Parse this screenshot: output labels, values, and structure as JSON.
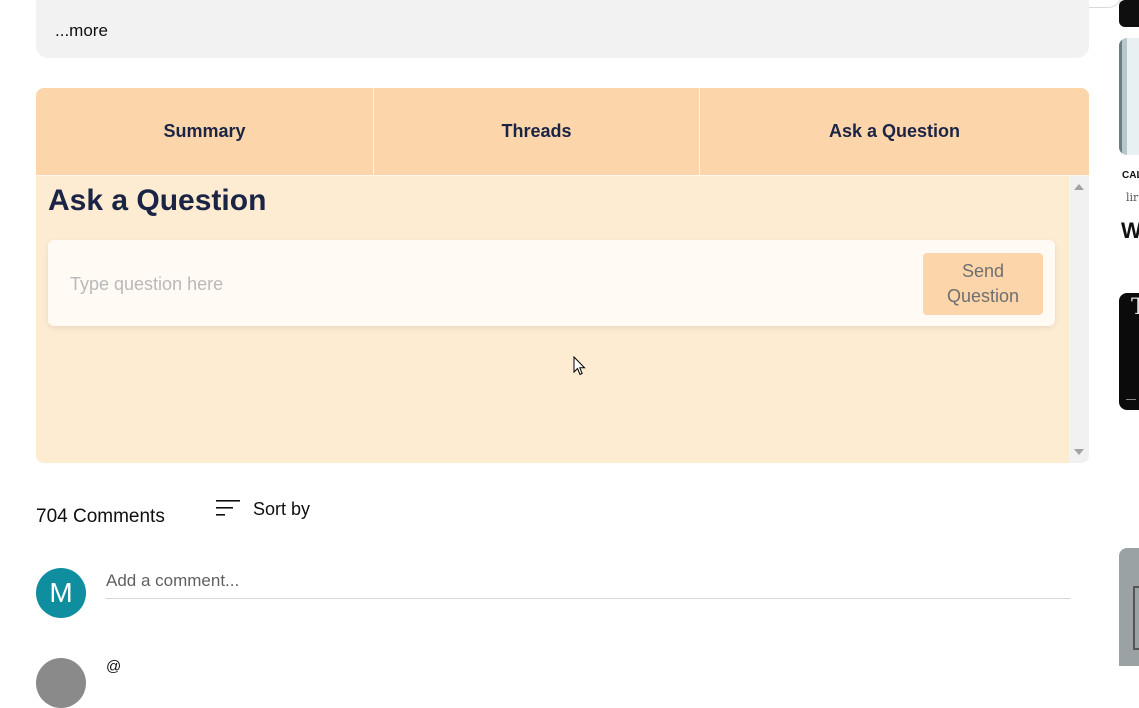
{
  "description": {
    "more_label": "...more"
  },
  "tabs": [
    {
      "label": "Summary"
    },
    {
      "label": "Threads"
    },
    {
      "label": "Ask a Question"
    }
  ],
  "ask": {
    "title": "Ask a Question",
    "input_placeholder": "Type question here",
    "send_label_line1": "Send",
    "send_label_line2": "Question"
  },
  "comments": {
    "count_label": "704 Comments",
    "sort_label": "Sort by",
    "avatar_letter": "M",
    "add_comment_placeholder": "Add a comment...",
    "first_comment_user": "@",
    "first_comment_time": ""
  },
  "sidebar": {
    "small_text": "CAL",
    "math_text": "lir",
    "big_text": "W"
  },
  "colors": {
    "tab_bar": "#fcd6aa",
    "panel_bg": "#fdebd2",
    "title_navy": "#1b2445",
    "avatar_teal": "#0f8e9f"
  }
}
